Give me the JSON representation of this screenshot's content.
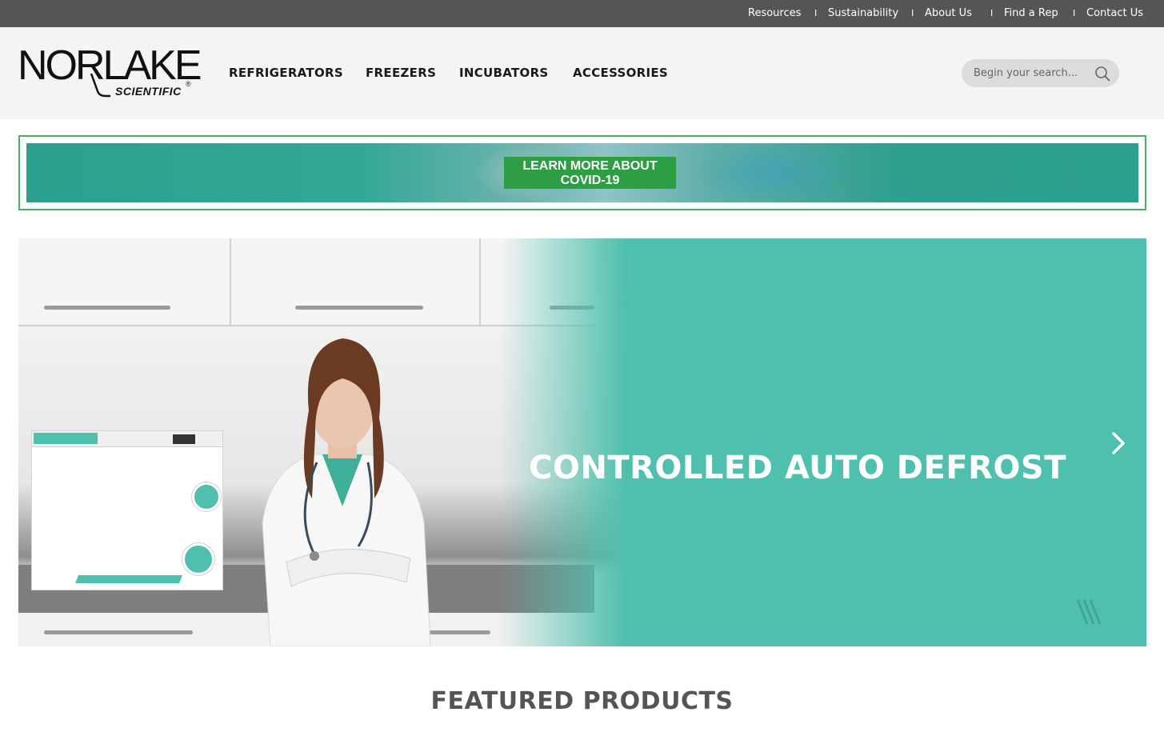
{
  "topbar": {
    "links": [
      "Resources",
      "Sustainability",
      "About Us",
      "Find a Rep",
      "Contact Us"
    ],
    "separator": "I"
  },
  "brand": {
    "name": "NORLAKE",
    "tagline": "SCIENTIFIC",
    "registered": "®"
  },
  "nav": {
    "items": [
      "REFRIGERATORS",
      "FREEZERS",
      "INCUBATORS",
      "ACCESSORIES"
    ]
  },
  "search": {
    "placeholder": "Begin your search...",
    "icon": "search-icon"
  },
  "covid_banner": {
    "button_line1": "LEARN MORE ABOUT",
    "button_line2": "COVID-19",
    "border_color": "#4fb05c",
    "button_color": "#2e9e45"
  },
  "hero": {
    "title": "CONTROLLED AUTO DEFROST",
    "background_color": "#4fc0ad",
    "next_icon": "chevron-right-icon"
  },
  "featured": {
    "heading": "FEATURED PRODUCTS"
  },
  "colors": {
    "topbar": "#555555",
    "header": "#f4f4f4",
    "accent_teal": "#4fc0ad"
  }
}
